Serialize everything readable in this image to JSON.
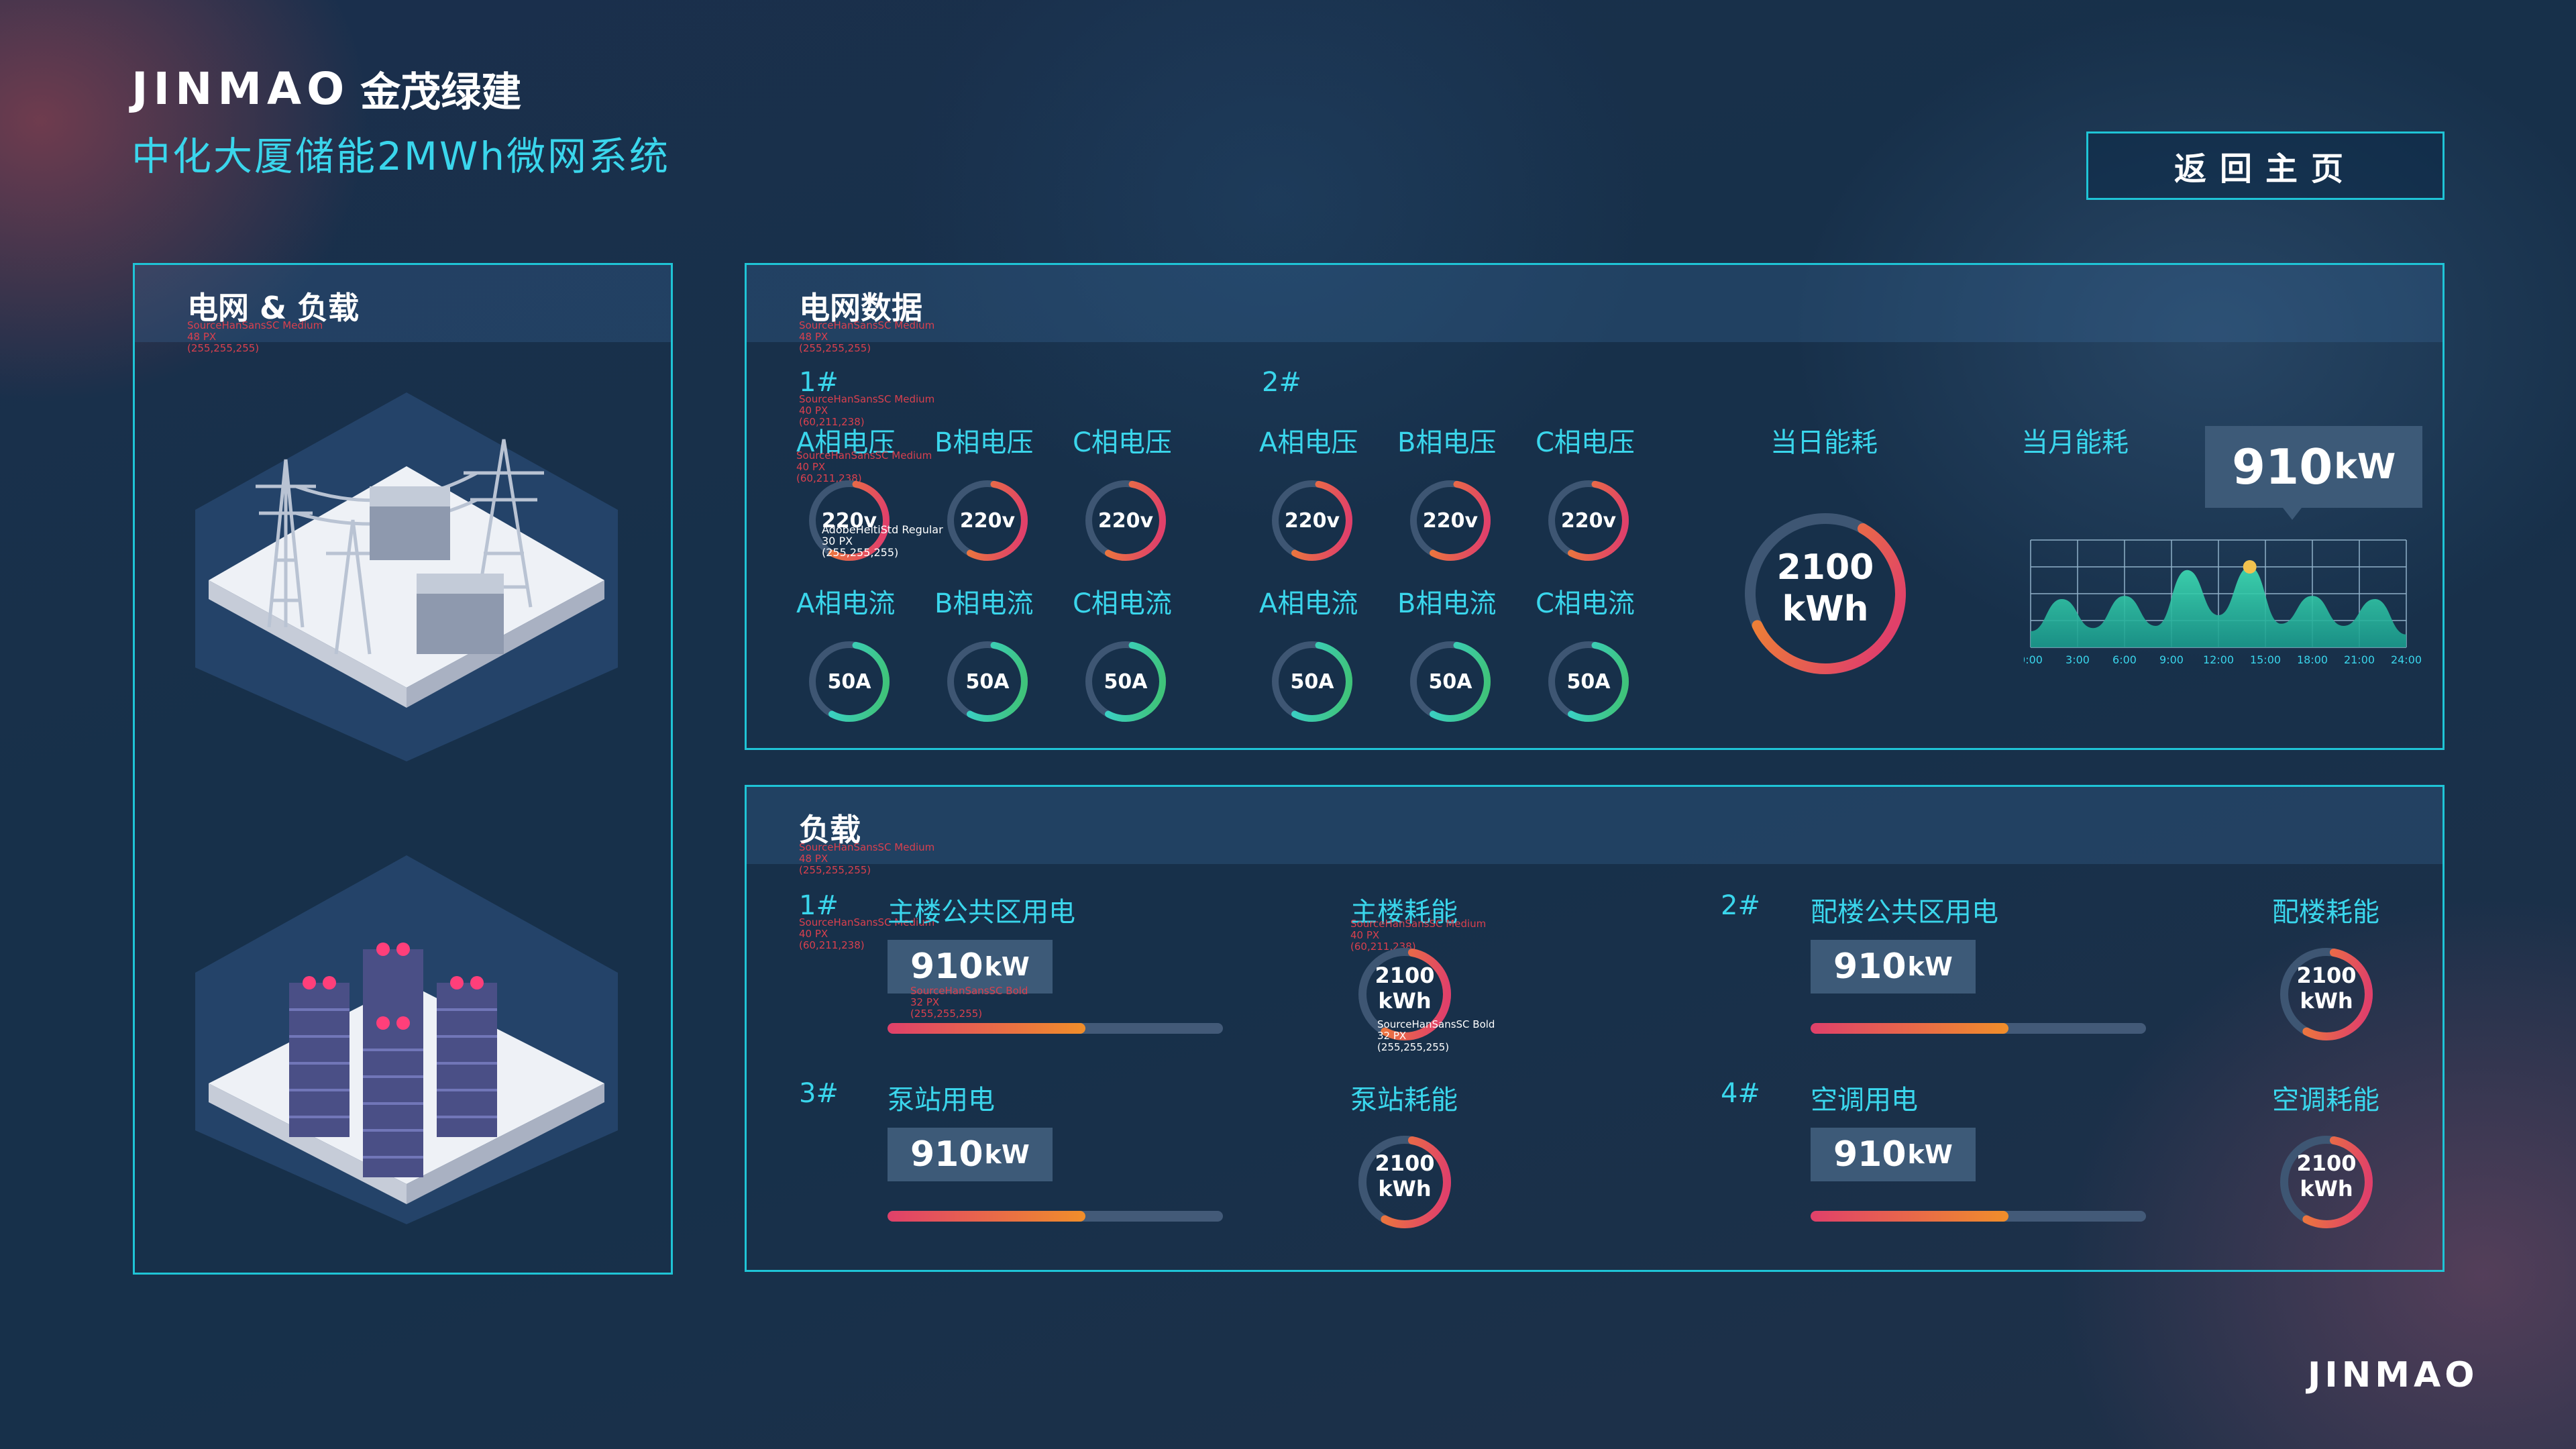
{
  "brand": {
    "wordmark": "JINMAO",
    "name_cn": "金茂绿建",
    "footer_logo": "JINMAO"
  },
  "header": {
    "subtitle": "中化大厦储能2MWh微网系统"
  },
  "home_button": {
    "label": "返回主页"
  },
  "annotations": {
    "medium48": [
      "SourceHanSansSC Medium",
      "48 PX",
      "(255,255,255)"
    ],
    "medium40": [
      "SourceHanSansSC Medium",
      "40 PX",
      "(60,211,238)"
    ],
    "medium40b": [
      "SourceHanSansSC Medium",
      "40 PX",
      "(60,211,238)"
    ],
    "adobe30": [
      "AdobeHeitiStd Regular",
      "30 PX",
      "(255,255,255)"
    ],
    "bold32": [
      "SourceHanSansSC Bold",
      "32 PX",
      "(255,255,255)"
    ]
  },
  "left_panel": {
    "title": "电网 & 负载",
    "icons": [
      "transmission-tower-icon",
      "server-rack-icon"
    ]
  },
  "grid_panel": {
    "title": "电网数据",
    "groups": [
      {
        "id": "1#",
        "voltage_labels": [
          "A相电压",
          "B相电压",
          "C相电压"
        ],
        "voltages": [
          "220v",
          "220v",
          "220v"
        ],
        "current_labels": [
          "A相电流",
          "B相电流",
          "C相电流"
        ],
        "currents": [
          "50A",
          "50A",
          "50A"
        ]
      },
      {
        "id": "2#",
        "voltage_labels": [
          "A相电压",
          "B相电压",
          "C相电压"
        ],
        "voltages": [
          "220v",
          "220v",
          "220v"
        ],
        "current_labels": [
          "A相电流",
          "B相电流",
          "C相电流"
        ],
        "currents": [
          "50A",
          "50A",
          "50A"
        ]
      }
    ],
    "daily": {
      "label": "当日能耗",
      "value_line1": "2100",
      "value_line2": "kWh"
    },
    "monthly": {
      "label": "当月能耗",
      "value": "910",
      "unit": "kW"
    }
  },
  "chart_data": {
    "type": "area",
    "x": [
      "0:00",
      "3:00",
      "6:00",
      "9:00",
      "12:00",
      "15:00",
      "18:00",
      "21:00",
      "24:00"
    ],
    "series": [
      {
        "values": [
          0.15,
          0.45,
          0.18,
          0.48,
          0.2,
          0.72,
          0.3,
          0.75,
          0.22,
          0.48,
          0.2,
          0.45,
          0.12
        ]
      }
    ],
    "grid": true
  },
  "load_panel": {
    "title": "负载",
    "rows": [
      {
        "id": "1#",
        "label": "主楼公共区用电",
        "power": "910",
        "unit": "kW",
        "progress": 0.59,
        "energy_label": "主楼耗能",
        "energy_line1": "2100",
        "energy_line2": "kWh"
      },
      {
        "id": "2#",
        "label": "配楼公共区用电",
        "power": "910",
        "unit": "kW",
        "progress": 0.59,
        "energy_label": "配楼耗能",
        "energy_line1": "2100",
        "energy_line2": "kWh"
      },
      {
        "id": "3#",
        "label": "泵站用电",
        "power": "910",
        "unit": "kW",
        "progress": 0.59,
        "energy_label": "泵站耗能",
        "energy_line1": "2100",
        "energy_line2": "kWh"
      },
      {
        "id": "4#",
        "label": "空调用电",
        "power": "910",
        "unit": "kW",
        "progress": 0.59,
        "energy_label": "空调耗能",
        "energy_line1": "2100",
        "energy_line2": "kWh"
      }
    ]
  },
  "colors": {
    "accent": "#3ad6ec",
    "border": "#1fc4d6",
    "gradient_start": "#e0406a",
    "gradient_end": "#f08e2a"
  }
}
